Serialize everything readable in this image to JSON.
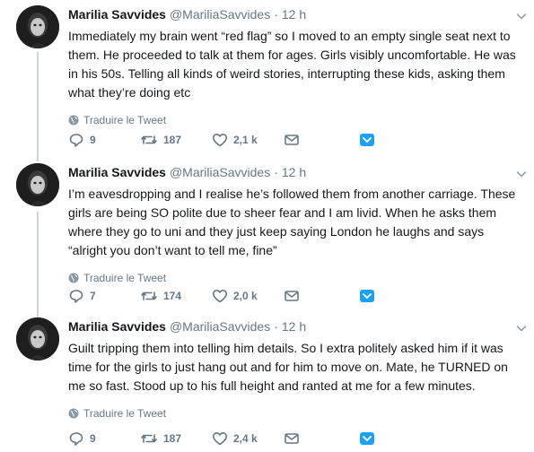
{
  "tweets": [
    {
      "name": "Marilia Savvides",
      "handle": "@MariliaSavvides",
      "dot": "·",
      "time": "12 h",
      "text": "Immediately my brain went “red flag” so I moved to an empty single seat next to them. He proceeded to talk at them for ages. Girls visibly uncomfortable. He was in his 50s. Telling all kinds of weird stories, interrupting these kids, asking them what they’re doing etc",
      "translate": "Traduire le Tweet",
      "replies": "9",
      "retweets": "187",
      "likes": "2,1 k"
    },
    {
      "name": "Marilia Savvides",
      "handle": "@MariliaSavvides",
      "dot": "·",
      "time": "12 h",
      "text": "I’m eavesdropping and I realise he’s followed them from another carriage. These girls are being SO polite due to sheer fear and I am livid. When he asks them where they go to uni and they just keep saying London he laughs and says “alright you don’t want to tell me, fine”",
      "translate": "Traduire le Tweet",
      "replies": "7",
      "retweets": "174",
      "likes": "2,0 k"
    },
    {
      "name": "Marilia Savvides",
      "handle": "@MariliaSavvides",
      "dot": "·",
      "time": "12 h",
      "text": "Guilt tripping them into telling him details. So I extra politely asked him if it was time for the girls to just hang out and for him to move on. Mate, he TURNED on me so fast. Stood up to his full height and ranted at me for a few minutes.",
      "translate": "Traduire le Tweet",
      "replies": "9",
      "retweets": "187",
      "likes": "2,4 k"
    }
  ],
  "icons": {
    "reply": "speech-bubble-icon",
    "retweet": "retweet-icon",
    "like": "heart-icon",
    "dm": "envelope-icon",
    "save": "save-icon",
    "caret": "chevron-down-icon",
    "translate": "globe-icon"
  },
  "colors": {
    "text": "#14171a",
    "muted": "#657786",
    "thread_line": "#ccd6dd",
    "save_icon": "#1da1f2"
  }
}
